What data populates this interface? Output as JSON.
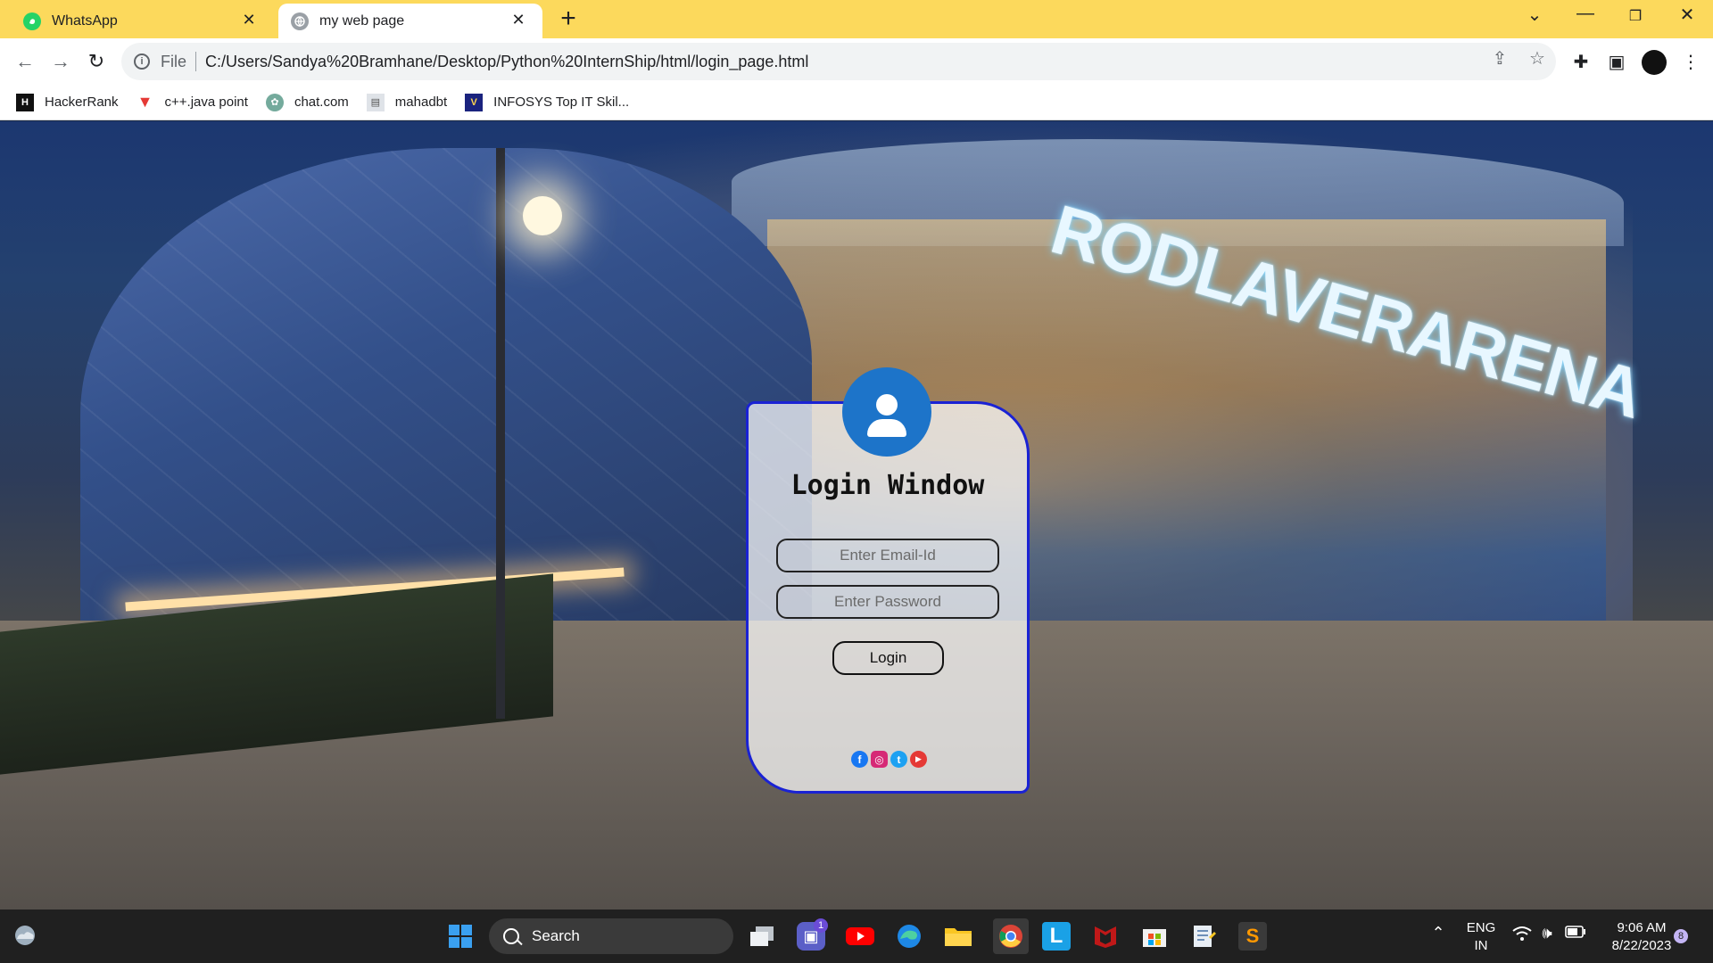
{
  "browser": {
    "tabs": [
      {
        "title": "WhatsApp",
        "icon": "whatsapp-icon",
        "active": false
      },
      {
        "title": "my web page",
        "icon": "globe-icon",
        "active": true
      }
    ],
    "new_tab": "+",
    "address": {
      "scheme": "File",
      "url": "C:/Users/Sandya%20Bramhane/Desktop/Python%20InternShip/html/login_page.html"
    },
    "bookmarks": [
      {
        "label": "HackerRank",
        "icon": "hackerrank-icon",
        "color": "#111111"
      },
      {
        "label": "c++.java point",
        "icon": "javatpoint-icon",
        "color": "#e53935"
      },
      {
        "label": "chat.com",
        "icon": "chatgpt-icon",
        "color": "#74aa9c"
      },
      {
        "label": "mahadbt",
        "icon": "mahadbt-icon",
        "color": "#9e9e9e"
      },
      {
        "label": "INFOSYS Top IT Skil...",
        "icon": "infosys-icon",
        "color": "#1a237e"
      }
    ]
  },
  "background": {
    "sign_text": "RODLAVERARENA"
  },
  "login": {
    "title": "Login Window",
    "email_placeholder": "Enter Email-Id",
    "password_placeholder": "Enter Password",
    "button_label": "Login",
    "border_color": "#1a22d4",
    "avatar_color": "#1d74c9",
    "social": [
      {
        "name": "facebook-icon",
        "glyph": "f",
        "color": "#1877f2"
      },
      {
        "name": "instagram-icon",
        "glyph": "◎",
        "color": "#d62976"
      },
      {
        "name": "twitter-icon",
        "glyph": "t",
        "color": "#1da1f2"
      },
      {
        "name": "youtube-icon",
        "glyph": "▶",
        "color": "#e53935"
      }
    ]
  },
  "taskbar": {
    "search_label": "Search",
    "teams_badge": "1",
    "lang_top": "ENG",
    "lang_bottom": "IN",
    "time": "9:06 AM",
    "date": "8/22/2023",
    "notification_count": "8"
  }
}
